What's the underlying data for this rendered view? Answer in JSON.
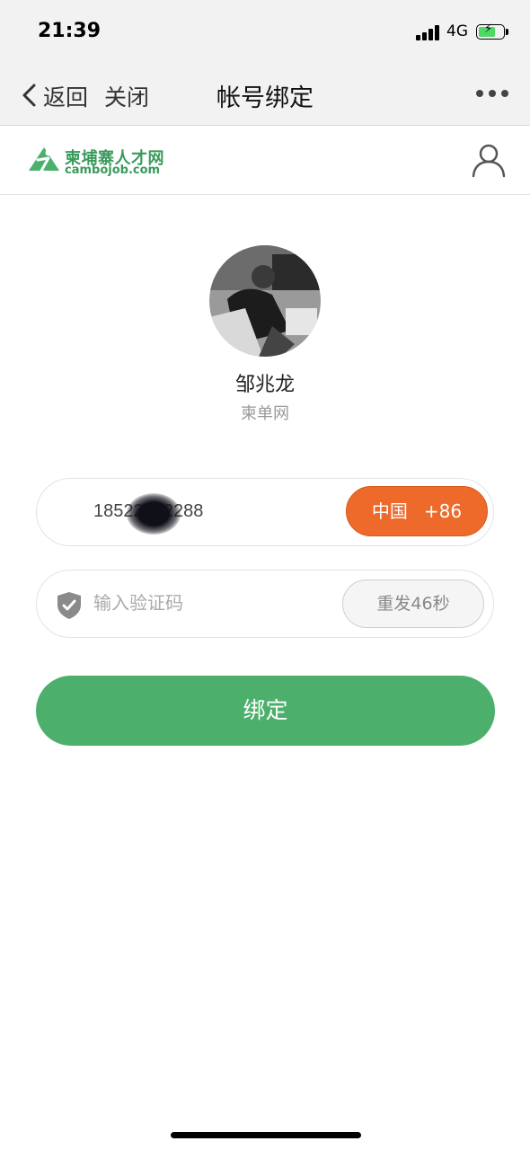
{
  "status_bar": {
    "time": "21:39",
    "network": "4G"
  },
  "nav": {
    "back_label": "返回",
    "close_label": "关闭",
    "title": "帐号绑定"
  },
  "brand": {
    "name_cn": "柬埔寨人才网",
    "name_en": "cambojob.com",
    "color": "#3a9a5c"
  },
  "profile": {
    "name": "邹兆龙",
    "company": "柬单网"
  },
  "form": {
    "phone_value": "18522262288",
    "country_label": "中国",
    "country_code": "+86",
    "code_placeholder": "输入验证码",
    "resend_label": "重发46秒",
    "submit_label": "绑定"
  },
  "colors": {
    "accent_orange": "#ed6a2b",
    "primary_green": "#4caf6c"
  }
}
